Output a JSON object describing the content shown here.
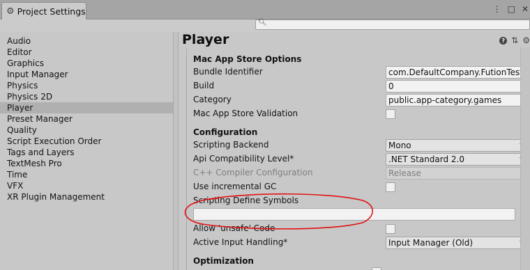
{
  "window": {
    "tab_title": "Project Settings",
    "tab_icon": "gear-icon",
    "more_icon": "⋮",
    "maximize_icon": "□",
    "close_icon": "✕"
  },
  "search": {
    "placeholder": "",
    "value": ""
  },
  "sidebar": {
    "items": [
      {
        "label": "Audio"
      },
      {
        "label": "Editor"
      },
      {
        "label": "Graphics"
      },
      {
        "label": "Input Manager"
      },
      {
        "label": "Physics"
      },
      {
        "label": "Physics 2D"
      },
      {
        "label": "Player",
        "selected": true
      },
      {
        "label": "Preset Manager"
      },
      {
        "label": "Quality"
      },
      {
        "label": "Script Execution Order"
      },
      {
        "label": "Tags and Layers"
      },
      {
        "label": "TextMesh Pro"
      },
      {
        "label": "Time"
      },
      {
        "label": "VFX"
      },
      {
        "label": "XR Plugin Management"
      }
    ]
  },
  "main": {
    "title": "Player",
    "mac_app_store": {
      "heading": "Mac App Store Options",
      "bundle_identifier": {
        "label": "Bundle Identifier",
        "value": "com.DefaultCompany.FutionTest"
      },
      "build": {
        "label": "Build",
        "value": "0"
      },
      "category": {
        "label": "Category",
        "value": "public.app-category.games"
      },
      "validation": {
        "label": "Mac App Store Validation",
        "checked": false
      }
    },
    "configuration": {
      "heading": "Configuration",
      "scripting_backend": {
        "label": "Scripting Backend",
        "value": "Mono"
      },
      "api_compat": {
        "label": "Api Compatibility Level*",
        "value": ".NET Standard 2.0"
      },
      "cpp_compiler": {
        "label": "C++ Compiler Configuration",
        "value": "Release",
        "disabled": true
      },
      "incremental_gc": {
        "label": "Use incremental GC",
        "checked": false
      },
      "define_symbols": {
        "label": "Scripting Define Symbols",
        "value": ""
      },
      "allow_unsafe": {
        "label": "Allow 'unsafe' Code",
        "checked": false
      },
      "input_handling": {
        "label": "Active Input Handling*",
        "value": "Input Manager (Old)"
      }
    },
    "optimization": {
      "heading": "Optimization"
    }
  },
  "annotation_color": "#e01010"
}
